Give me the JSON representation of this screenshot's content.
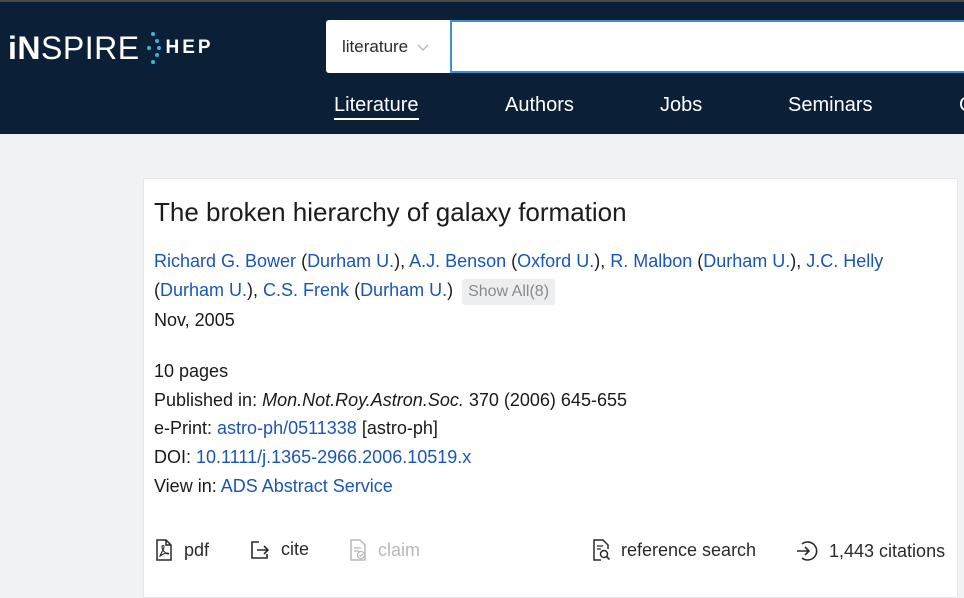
{
  "header": {
    "logo": {
      "part1": "iN",
      "part2": "SPIRE",
      "part3": "HEP"
    },
    "search": {
      "scope": "literature",
      "placeholder": ""
    },
    "nav": [
      "Literature",
      "Authors",
      "Jobs",
      "Seminars",
      "C"
    ]
  },
  "record": {
    "title": "The broken hierarchy of galaxy formation",
    "authors": [
      {
        "name": "Richard G. Bower",
        "affiliation": "Durham U."
      },
      {
        "name": "A.J. Benson",
        "affiliation": "Oxford U."
      },
      {
        "name": "R. Malbon",
        "affiliation": "Durham U."
      },
      {
        "name": "J.C. Helly",
        "affiliation": "Durham U."
      },
      {
        "name": "C.S. Frenk",
        "affiliation": "Durham U."
      }
    ],
    "show_all_label": "Show All(8)",
    "date": "Nov, 2005",
    "pages": "10 pages",
    "published_label": "Published in:",
    "journal": "Mon.Not.Roy.Astron.Soc.",
    "journal_detail": "370 (2006) 645-655",
    "eprint_label": "e-Print:",
    "eprint": "astro-ph/0511338",
    "eprint_category": "[astro-ph]",
    "doi_label": "DOI:",
    "doi": "10.1111/j.1365-2966.2006.10519.x",
    "view_label": "View in:",
    "view_link": "ADS Abstract Service"
  },
  "actions": {
    "pdf": "pdf",
    "cite": "cite",
    "claim": "claim",
    "reference_search": "reference search",
    "citations": "1,443 citations"
  },
  "colors": {
    "header_bg": "#0b2036",
    "link": "#1a56b3",
    "accent": "#3bb3e6"
  }
}
